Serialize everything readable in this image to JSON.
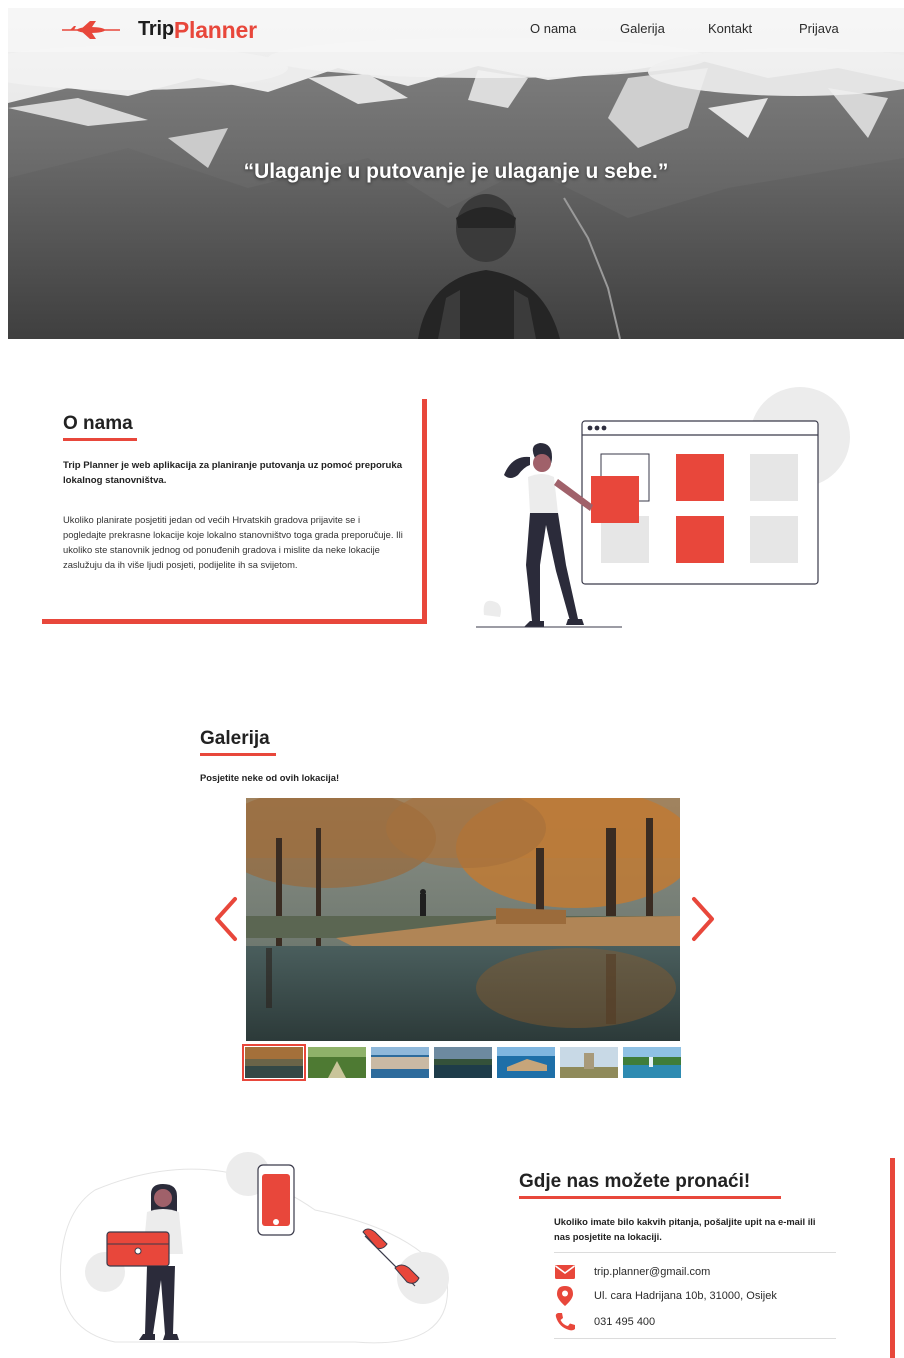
{
  "logo": {
    "part1": "Trip",
    "part2": "Planner"
  },
  "nav": {
    "items": [
      {
        "label": "O nama"
      },
      {
        "label": "Galerija"
      },
      {
        "label": "Kontakt"
      },
      {
        "label": "Prijava"
      }
    ]
  },
  "hero": {
    "quote": "“Ulaganje u putovanje je ulaganje u sebe.”"
  },
  "about": {
    "title": "O nama",
    "lead": "Trip Planner je web aplikacija za planiranje putovanja uz pomoć preporuka lokalnog stanovništva.",
    "body": "Ukoliko planirate posjetiti jedan od većih Hrvatskih gradova prijavite se i pogledajte prekrasne lokacije koje lokalno stanovništvo toga grada preporučuje. Ili ukoliko ste stanovnik jednog od ponuđenih gradova i mislite da neke lokacije zaslužuju da ih više ljudi posjeti, podijelite ih sa svijetom."
  },
  "gallery": {
    "title": "Galerija",
    "subtitle": "Posjetite neke od ovih lokacija!",
    "active_index": 0,
    "thumb_count": 7
  },
  "contact": {
    "title": "Gdje nas možete pronaći!",
    "text": "Ukoliko imate bilo kakvih pitanja, pošaljite upit na e-mail ili nas posjetite na lokaciji.",
    "email": "trip.planner@gmail.com",
    "address": "Ul. cara Hadrijana 10b, 31000, Osijek",
    "phone": "031 495 400"
  },
  "colors": {
    "accent": "#e8473b",
    "text": "#222222",
    "light_gray": "#e6e6e6"
  },
  "icons": {
    "logo": "plane-icon",
    "email": "envelope-icon",
    "address": "map-pin-icon",
    "phone": "phone-icon",
    "prev": "chevron-left-icon",
    "next": "chevron-right-icon"
  }
}
